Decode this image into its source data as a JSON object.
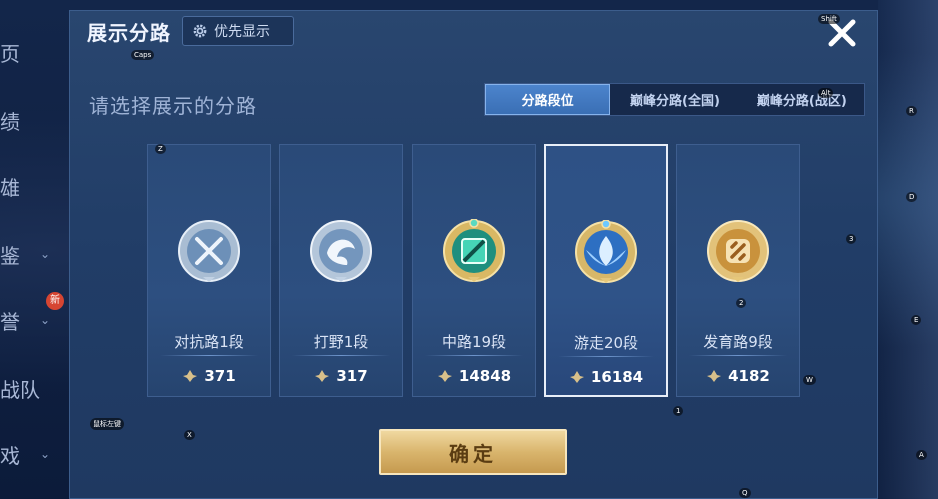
{
  "dialog": {
    "title": "展示分路",
    "priority_button": "优先显示",
    "subtitle": "请选择展示的分路",
    "confirm": "确定"
  },
  "tabs": [
    {
      "label": "分路段位",
      "active": true
    },
    {
      "label": "巅峰分路(全国)",
      "active": false
    },
    {
      "label": "巅峰分路(战区)",
      "active": false
    }
  ],
  "cards": [
    {
      "lane": "对抗路1段",
      "score": "371",
      "emblem": "silver-sword-emblem-icon",
      "selected": false
    },
    {
      "lane": "打野1段",
      "score": "317",
      "emblem": "silver-dragon-emblem-icon",
      "selected": false
    },
    {
      "lane": "中路19段",
      "score": "14848",
      "emblem": "green-gold-emblem-icon",
      "selected": false
    },
    {
      "lane": "游走20段",
      "score": "16184",
      "emblem": "blue-wing-emblem-icon",
      "selected": true
    },
    {
      "lane": "发育路9段",
      "score": "4182",
      "emblem": "gold-emblem-icon",
      "selected": false
    }
  ],
  "left_menu": {
    "items": [
      "页",
      "绩",
      "雄",
      "鉴",
      "誉",
      "战队",
      "戏"
    ],
    "new_badge": "新"
  },
  "key_hints": [
    "Caps",
    "Z",
    "X",
    "Shift",
    "Alt",
    "R",
    "D",
    "3",
    "2",
    "E",
    "W",
    "1",
    "A",
    "Q",
    "鼠标左键"
  ],
  "colors": {
    "accent": "#3a6fb5",
    "confirm": "#d9b56d",
    "score_icon": "#d8c08a"
  }
}
